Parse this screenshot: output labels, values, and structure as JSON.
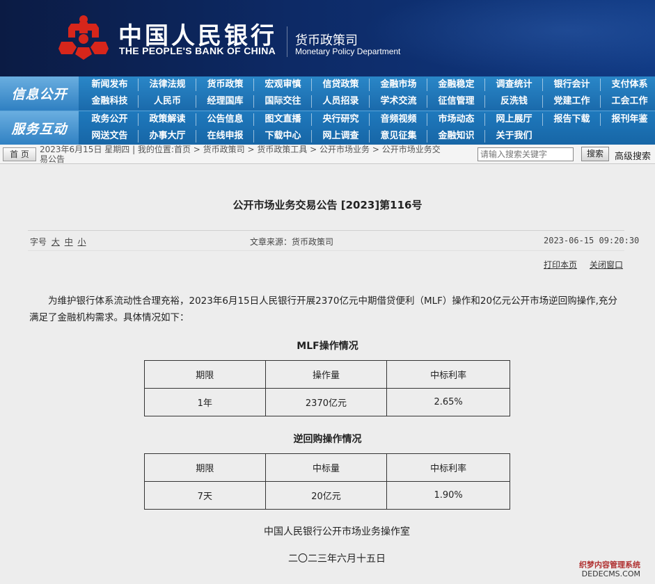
{
  "header": {
    "bank_cn": "中国人民银行",
    "bank_en": "THE PEOPLE'S BANK OF CHINA",
    "dept_cn": "货币政策司",
    "dept_en": "Monetary Policy Department"
  },
  "nav": {
    "info_heading": "信息公开",
    "service_heading": "服务互动",
    "row1": [
      "新闻发布",
      "法律法规",
      "货币政策",
      "宏观审慎",
      "信贷政策",
      "金融市场",
      "金融稳定",
      "调查统计",
      "银行会计",
      "支付体系"
    ],
    "row2": [
      "金融科技",
      "人民币",
      "经理国库",
      "国际交往",
      "人员招录",
      "学术交流",
      "征信管理",
      "反洗钱",
      "党建工作",
      "工会工作"
    ],
    "row3": [
      "政务公开",
      "政策解读",
      "公告信息",
      "图文直播",
      "央行研究",
      "音频视频",
      "市场动态",
      "网上展厅",
      "报告下载",
      "报刊年鉴"
    ],
    "row4": [
      "网送文告",
      "办事大厅",
      "在线申报",
      "下载中心",
      "网上调查",
      "意见征集",
      "金融知识",
      "关于我们"
    ]
  },
  "crumbbar": {
    "home": "首 页",
    "line1": "2023年6月15日 星期四 | 我的位置:首页 > 货币政策司 > 货币政策工具 > 公开市场业务 > 公开市场业务交",
    "line2": "易公告",
    "search_placeholder": "请输入搜索关键字",
    "search_button": "搜索",
    "advanced_search": "高级搜索"
  },
  "article": {
    "title": "公开市场业务交易公告 [2023]第116号",
    "font_size_label": "字号",
    "font_sizes": [
      "大",
      "中",
      "小"
    ],
    "source": "文章来源：货币政策司",
    "datetime": "2023-06-15 09:20:30",
    "print": "打印本页",
    "close": "关闭窗口",
    "paragraph": "为维护银行体系流动性合理充裕，2023年6月15日人民银行开展2370亿元中期借贷便利（MLF）操作和20亿元公开市场逆回购操作,充分满足了金融机构需求。具体情况如下："
  },
  "mlf": {
    "title": "MLF操作情况",
    "headers": [
      "期限",
      "操作量",
      "中标利率"
    ],
    "row": [
      "1年",
      "2370亿元",
      "2.65%"
    ]
  },
  "reverse_repo": {
    "title": "逆回购操作情况",
    "headers": [
      "期限",
      "中标量",
      "中标利率"
    ],
    "row": [
      "7天",
      "20亿元",
      "1.90%"
    ]
  },
  "signature": {
    "office": "中国人民银行公开市场业务操作室",
    "date": "二〇二三年六月十五日"
  },
  "watermark": {
    "line1": "织梦内容管理系统",
    "line2": "DEDECMS.COM"
  },
  "colors": {
    "banner": "#0d2a66",
    "nav": "#1e78bb",
    "logo_red": "#d7261b",
    "page_bg": "#ededed"
  }
}
